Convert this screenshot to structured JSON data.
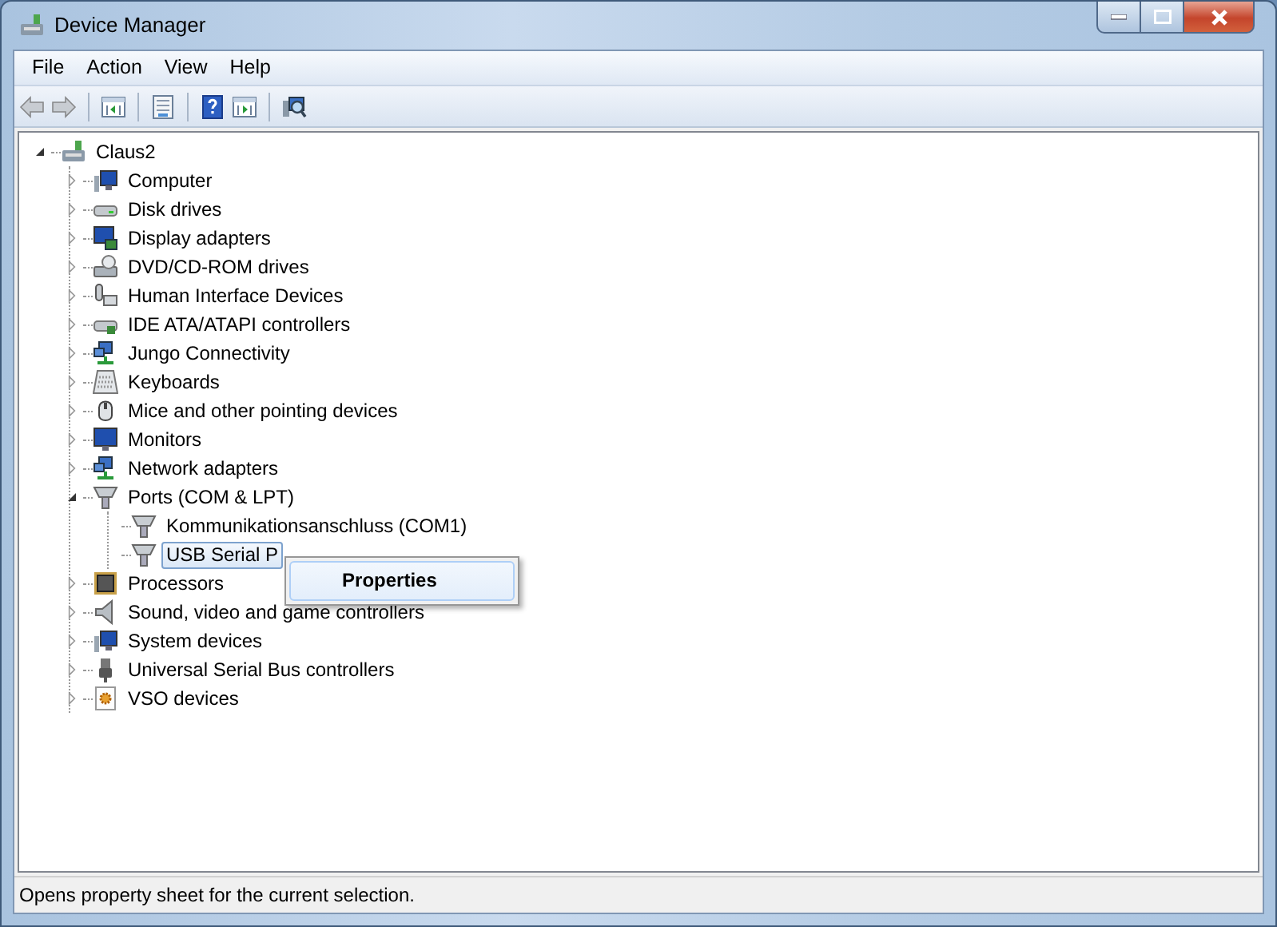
{
  "window": {
    "title": "Device Manager"
  },
  "menu": [
    "File",
    "Action",
    "View",
    "Help"
  ],
  "toolbar": [
    {
      "kind": "back",
      "disabled": true
    },
    {
      "kind": "forward",
      "disabled": true
    },
    {
      "kind": "separator"
    },
    {
      "kind": "tree-pane",
      "disabled": false
    },
    {
      "kind": "separator"
    },
    {
      "kind": "properties",
      "disabled": false
    },
    {
      "kind": "separator"
    },
    {
      "kind": "help",
      "disabled": false
    },
    {
      "kind": "action-pane",
      "disabled": false
    },
    {
      "kind": "separator"
    },
    {
      "kind": "scan",
      "disabled": false
    }
  ],
  "tree": {
    "label": "Claus2",
    "kind": "computer-root",
    "expanded": true,
    "selected": false,
    "children": [
      {
        "label": "Computer",
        "kind": "computer",
        "expanded": false,
        "selected": false
      },
      {
        "label": "Disk drives",
        "kind": "disk",
        "expanded": false,
        "selected": false
      },
      {
        "label": "Display adapters",
        "kind": "display",
        "expanded": false,
        "selected": false
      },
      {
        "label": "DVD/CD-ROM drives",
        "kind": "optical",
        "expanded": false,
        "selected": false
      },
      {
        "label": "Human Interface Devices",
        "kind": "hid",
        "expanded": false,
        "selected": false
      },
      {
        "label": "IDE ATA/ATAPI controllers",
        "kind": "ide",
        "expanded": false,
        "selected": false
      },
      {
        "label": "Jungo Connectivity",
        "kind": "network",
        "expanded": false,
        "selected": false
      },
      {
        "label": "Keyboards",
        "kind": "keyboard",
        "expanded": false,
        "selected": false
      },
      {
        "label": "Mice and other pointing devices",
        "kind": "mouse",
        "expanded": false,
        "selected": false
      },
      {
        "label": "Monitors",
        "kind": "monitor",
        "expanded": false,
        "selected": false
      },
      {
        "label": "Network adapters",
        "kind": "network",
        "expanded": false,
        "selected": false
      },
      {
        "label": "Ports (COM & LPT)",
        "kind": "port",
        "expanded": true,
        "selected": false,
        "children": [
          {
            "label": "Kommunikationsanschluss (COM1)",
            "kind": "port",
            "selected": false
          },
          {
            "label": "USB Serial P",
            "kind": "port",
            "selected": true
          }
        ]
      },
      {
        "label": "Processors",
        "kind": "chip",
        "expanded": false,
        "selected": false
      },
      {
        "label": "Sound, video and game controllers",
        "kind": "speaker",
        "expanded": false,
        "selected": false
      },
      {
        "label": "System devices",
        "kind": "computer",
        "expanded": false,
        "selected": false
      },
      {
        "label": "Universal Serial Bus controllers",
        "kind": "usb",
        "expanded": false,
        "selected": false
      },
      {
        "label": "VSO devices",
        "kind": "gear",
        "expanded": false,
        "selected": false
      }
    ]
  },
  "context_menu": [
    {
      "label": "Properties",
      "bold": true,
      "highlighted": true
    }
  ],
  "status_bar": "Opens property sheet for the current selection."
}
